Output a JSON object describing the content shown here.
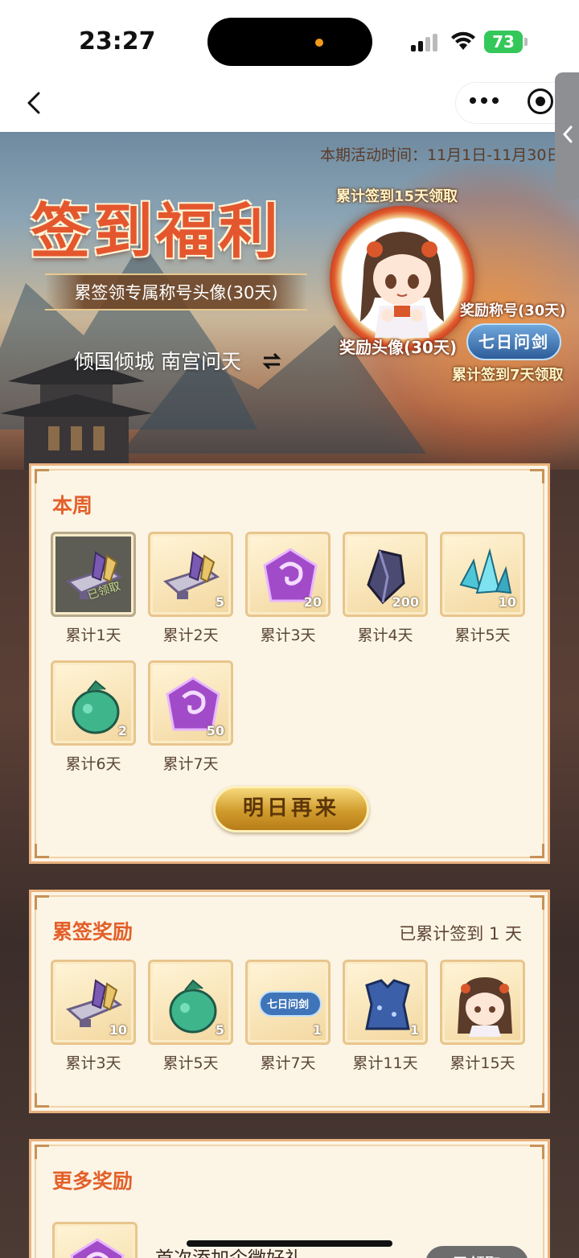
{
  "status_bar": {
    "time": "23:27",
    "battery": "73"
  },
  "banner": {
    "period": "本期活动时间：11月1日-11月30日",
    "title": "签到福利",
    "subtitle": "累签领专属称号头像(30天)",
    "names": "倾国倾城 南宫问天",
    "cum15_label": "累计签到15天领取",
    "reward_avatar_label": "奖励头像(30天)",
    "reward_title_label": "奖励称号(30天)",
    "seven_badge": "七日问剑",
    "cum7_label": "累计签到7天领取"
  },
  "this_week": {
    "title": "本周",
    "items": [
      {
        "day": "累计1天",
        "qty": "",
        "icon": "scroll-icon",
        "claimed": "已领取"
      },
      {
        "day": "累计2天",
        "qty": "5",
        "icon": "scroll-icon"
      },
      {
        "day": "累计3天",
        "qty": "20",
        "icon": "purple-token-icon"
      },
      {
        "day": "累计4天",
        "qty": "200",
        "icon": "dark-crystal-icon"
      },
      {
        "day": "累计5天",
        "qty": "10",
        "icon": "cyan-crystal-icon"
      },
      {
        "day": "累计6天",
        "qty": "2",
        "icon": "green-pouch-icon"
      },
      {
        "day": "累计7天",
        "qty": "50",
        "icon": "purple-token-icon"
      }
    ],
    "button": "明日再来"
  },
  "cumulative": {
    "title": "累签奖励",
    "status": "已累计签到 1 天",
    "items": [
      {
        "day": "累计3天",
        "qty": "10",
        "icon": "scroll-icon"
      },
      {
        "day": "累计5天",
        "qty": "5",
        "icon": "green-pouch-icon"
      },
      {
        "day": "累计7天",
        "qty": "1",
        "icon": "title-badge-icon",
        "badge": "七日问剑"
      },
      {
        "day": "累计11天",
        "qty": "1",
        "icon": "blue-robe-icon"
      },
      {
        "day": "累计15天",
        "qty": "",
        "icon": "avatar-icon"
      }
    ]
  },
  "more_rewards": {
    "title": "更多奖励",
    "row_name": "首次添加企微好礼",
    "row_button": "已领取"
  },
  "colors": {
    "accent": "#e3602a",
    "panel_bg": "#fcf5e6",
    "panel_border": "#e9b27e"
  }
}
